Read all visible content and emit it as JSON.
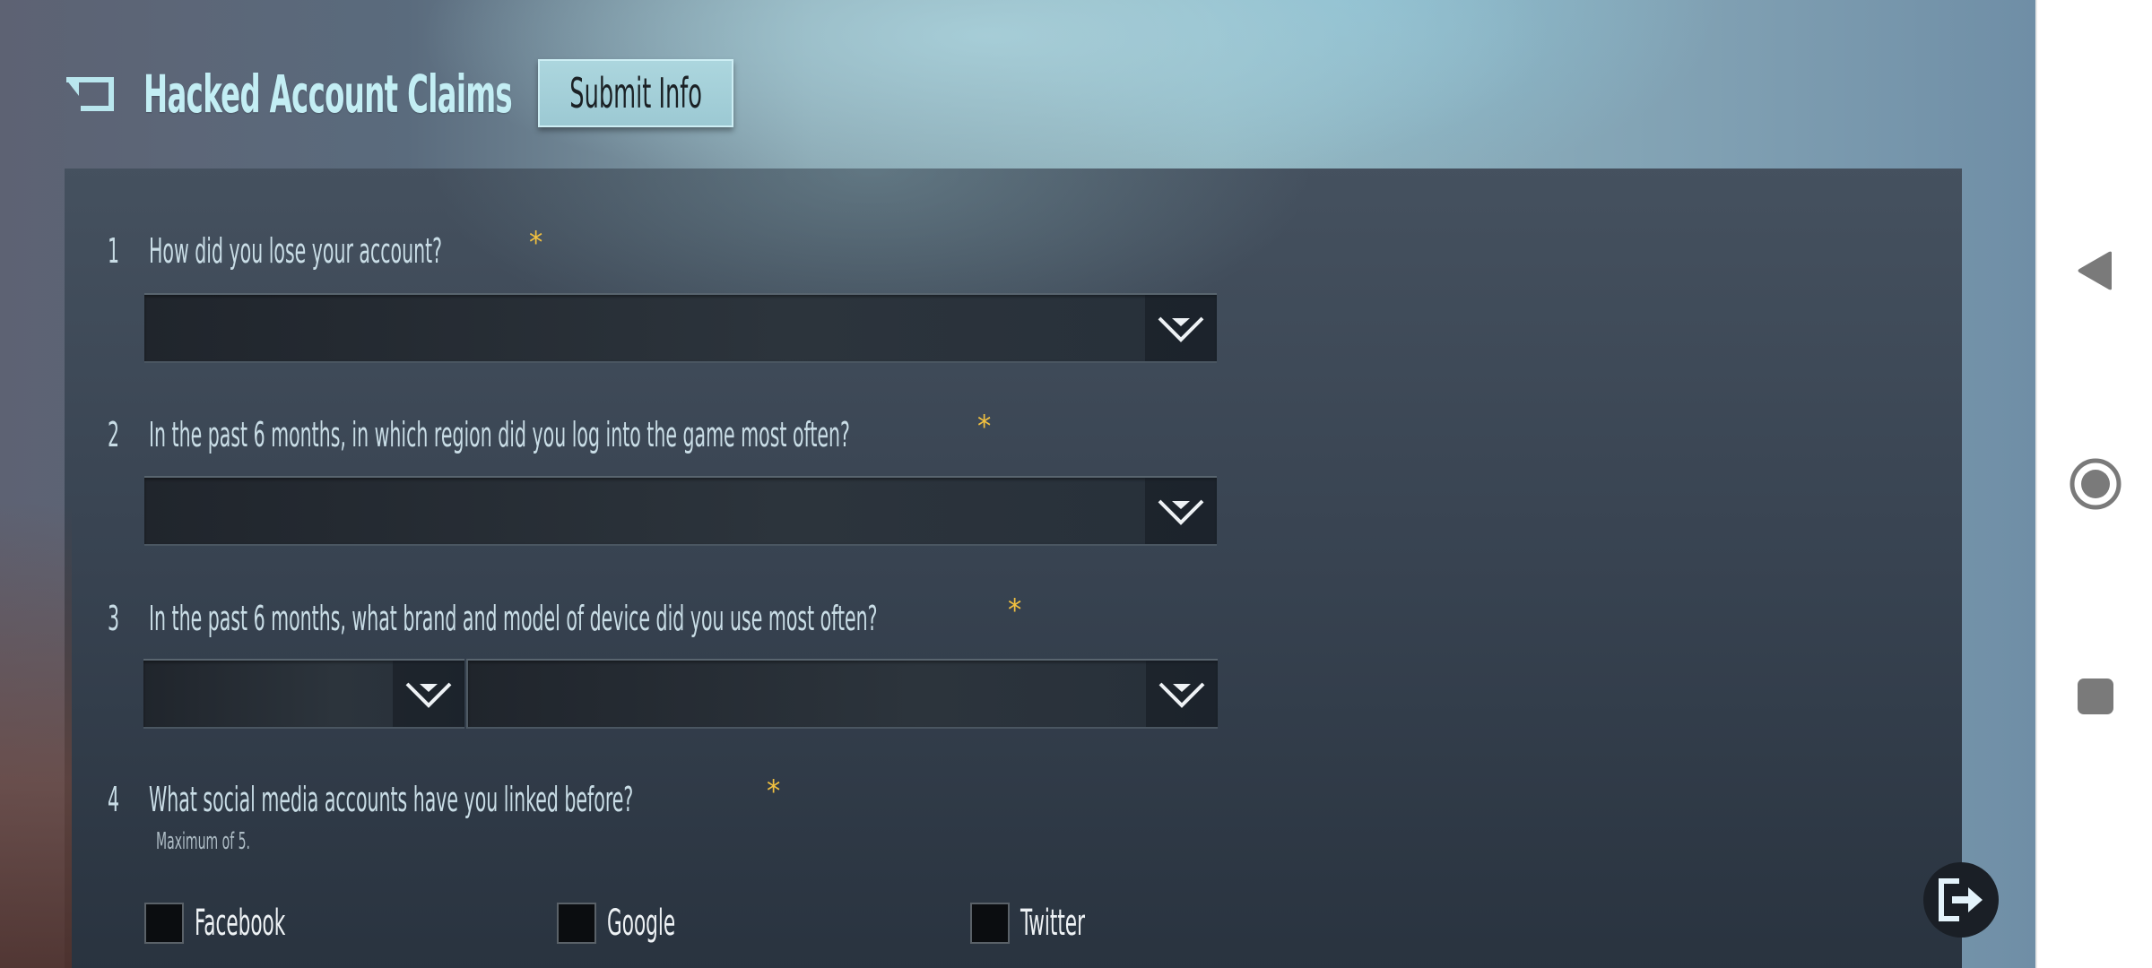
{
  "header": {
    "back_icon": "back-arrow-icon",
    "title": "Hacked Account Claims",
    "submit_label": "Submit Info"
  },
  "form": {
    "required_marker": "*",
    "questions": [
      {
        "number": "1",
        "text": "How did you lose your account?",
        "type": "select",
        "selected": ""
      },
      {
        "number": "2",
        "text": "In the past 6 months, in which region did you log into the game most often?",
        "type": "select",
        "selected": ""
      },
      {
        "number": "3",
        "text": "In the past 6 months, what brand and model of device did you use most often?",
        "type": "select-pair",
        "brand_selected": "",
        "model_selected": ""
      },
      {
        "number": "4",
        "text": "What social media accounts have you linked before?",
        "type": "checkbox",
        "hint": "Maximum of 5.",
        "options": [
          {
            "label": "Facebook",
            "checked": false
          },
          {
            "label": "Google",
            "checked": false
          },
          {
            "label": "Twitter",
            "checked": false
          }
        ]
      }
    ]
  },
  "floating": {
    "exit_icon": "exit-icon"
  },
  "navbar": {
    "back": "nav-back-icon",
    "home": "nav-home-icon",
    "recents": "nav-recents-icon"
  },
  "colors": {
    "title": "#c3eef4",
    "required": "#f0c040",
    "button_bg": "#a4d0d9",
    "nav_icon": "#7a7a7a"
  }
}
